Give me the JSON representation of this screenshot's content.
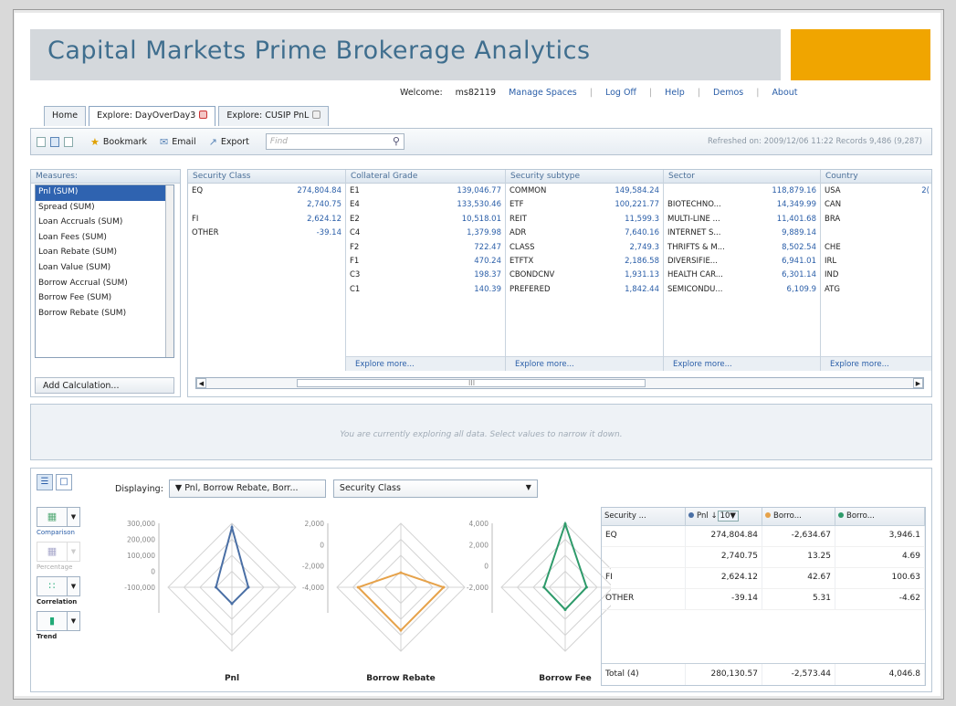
{
  "app": {
    "title": "Capital Markets Prime Brokerage Analytics",
    "accent_color": "#f0a500",
    "title_color": "#3f6e8e"
  },
  "topnav": {
    "welcome": "Welcome:",
    "user": "ms82119",
    "manage_spaces": "Manage Spaces",
    "log_off": "Log Off",
    "help": "Help",
    "demos": "Demos",
    "about": "About"
  },
  "tabs": [
    {
      "label": "Home"
    },
    {
      "label": "Explore: DayOverDay3"
    },
    {
      "label": "Explore: CUSIP PnL"
    }
  ],
  "toolbar": {
    "bookmark": "Bookmark",
    "email": "Email",
    "export": "Export",
    "find_placeholder": "Find",
    "refreshed": "Refreshed on: 2009/12/06 11:22 Records 9,486 (9,287)"
  },
  "measures": {
    "header": "Measures:",
    "items": [
      "Pnl (SUM)",
      "Spread (SUM)",
      "Loan Accruals (SUM)",
      "Loan Fees (SUM)",
      "Loan Rebate (SUM)",
      "Loan Value (SUM)",
      "Borrow Accrual (SUM)",
      "Borrow Fee (SUM)",
      "Borrow Rebate (SUM)"
    ],
    "add_calc": "Add Calculation..."
  },
  "grid": {
    "explore_more": "Explore more...",
    "columns": [
      {
        "header": "Security Class",
        "rows": [
          [
            "EQ",
            "274,804.84"
          ],
          [
            "",
            "2,740.75"
          ],
          [
            "FI",
            "2,624.12"
          ],
          [
            "OTHER",
            "-39.14"
          ]
        ]
      },
      {
        "header": "Collateral Grade",
        "rows": [
          [
            "E1",
            "139,046.77"
          ],
          [
            "E4",
            "133,530.46"
          ],
          [
            "E2",
            "10,518.01"
          ],
          [
            "C4",
            "1,379.98"
          ],
          [
            "F2",
            "722.47"
          ],
          [
            "F1",
            "470.24"
          ],
          [
            "C3",
            "198.37"
          ],
          [
            "C1",
            "140.39"
          ]
        ]
      },
      {
        "header": "Security subtype",
        "rows": [
          [
            "COMMON",
            "149,584.24"
          ],
          [
            "ETF",
            "100,221.77"
          ],
          [
            "REIT",
            "11,599.3"
          ],
          [
            "ADR",
            "7,640.16"
          ],
          [
            "CLASS",
            "2,749.3"
          ],
          [
            "ETFTX",
            "2,186.58"
          ],
          [
            "CBONDCNV",
            "1,931.13"
          ],
          [
            "PREFERED",
            "1,842.44"
          ]
        ]
      },
      {
        "header": "Sector",
        "rows": [
          [
            "",
            "118,879.16"
          ],
          [
            "BIOTECHNO...",
            "14,349.99"
          ],
          [
            "MULTI-LINE ...",
            "11,401.68"
          ],
          [
            "INTERNET S...",
            "9,889.14"
          ],
          [
            "THRIFTS & M...",
            "8,502.54"
          ],
          [
            "DIVERSIFIE...",
            "6,941.01"
          ],
          [
            "HEALTH CAR...",
            "6,301.14"
          ],
          [
            "SEMICONDU...",
            "6,109.9"
          ]
        ]
      },
      {
        "header": "Country",
        "rows": [
          [
            "USA",
            "2("
          ],
          [
            "CAN",
            ""
          ],
          [
            "BRA",
            ""
          ],
          [
            "",
            ""
          ],
          [
            "CHE",
            ""
          ],
          [
            "IRL",
            ""
          ],
          [
            "IND",
            ""
          ],
          [
            "ATG",
            ""
          ]
        ]
      }
    ],
    "scroll_mark": "III"
  },
  "filter": {
    "message": "You are currently exploring all data. Select values to narrow it down."
  },
  "chart": {
    "displaying_label": "Displaying:",
    "measures_select": "Pnl, Borrow Rebate, Borr...",
    "dimension_select": "Security Class",
    "tools": {
      "comparison": "Comparison",
      "percentage": "Percentage",
      "correlation": "Correlation",
      "trend": "Trend"
    }
  },
  "chart_data": [
    {
      "type": "radar",
      "title": "Pnl",
      "color": "#4a6fa5",
      "ticks": [
        "300,000",
        "200,000",
        "100,000",
        "0",
        "-100,000"
      ],
      "ylim": [
        -100000,
        300000
      ],
      "categories": [
        "EQ",
        "",
        "FI",
        "OTHER"
      ],
      "values": [
        274804.84,
        2740.75,
        2624.12,
        -39.14
      ]
    },
    {
      "type": "radar",
      "title": "Borrow Rebate",
      "color": "#e6a24a",
      "ticks": [
        "2,000",
        "0",
        "-2,000",
        "-4,000"
      ],
      "ylim": [
        -4000,
        2000
      ],
      "categories": [
        "EQ",
        "",
        "FI",
        "OTHER"
      ],
      "values": [
        -2634.67,
        13.25,
        42.67,
        5.31
      ]
    },
    {
      "type": "radar",
      "title": "Borrow Fee",
      "color": "#2e9a6a",
      "ticks": [
        "4,000",
        "2,000",
        "0",
        "-2,000"
      ],
      "ylim": [
        -2000,
        4000
      ],
      "categories": [
        "EQ",
        "",
        "FI",
        "OTHER"
      ],
      "values": [
        3946.1,
        4.69,
        100.63,
        -4.62
      ]
    }
  ],
  "table": {
    "headers": [
      "Security ...",
      "Pnl",
      "10",
      "Borro...",
      "Borro..."
    ],
    "rows": [
      [
        "EQ",
        "274,804.84",
        "-2,634.67",
        "3,946.1"
      ],
      [
        "",
        "2,740.75",
        "13.25",
        "4.69"
      ],
      [
        "FI",
        "2,624.12",
        "42.67",
        "100.63"
      ],
      [
        "OTHER",
        "-39.14",
        "5.31",
        "-4.62"
      ]
    ],
    "total": [
      "Total (4)",
      "280,130.57",
      "-2,573.44",
      "4,046.8"
    ]
  }
}
